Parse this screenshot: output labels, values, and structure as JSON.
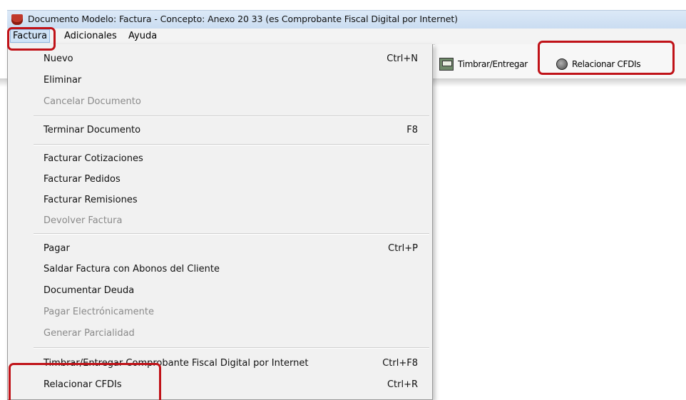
{
  "window": {
    "title": "Documento Modelo: Factura - Concepto: Anexo 20 33 (es Comprobante Fiscal Digital por Internet)"
  },
  "menubar": {
    "items": [
      "Factura",
      "Adicionales",
      "Ayuda"
    ]
  },
  "toolbar": {
    "timbrar_label": "Timbrar/Entregar",
    "relacionar_label": "Relacionar CFDIs"
  },
  "menu": {
    "items": [
      {
        "label": "Nuevo",
        "shortcut": "Ctrl+N",
        "enabled": true
      },
      {
        "label": "Eliminar",
        "shortcut": "",
        "enabled": true
      },
      {
        "label": "Cancelar Documento",
        "shortcut": "",
        "enabled": false
      },
      {
        "label": "Terminar Documento",
        "shortcut": "F8",
        "enabled": true
      },
      {
        "label": "Facturar Cotizaciones",
        "shortcut": "",
        "enabled": true
      },
      {
        "label": "Facturar Pedidos",
        "shortcut": "",
        "enabled": true
      },
      {
        "label": "Facturar Remisiones",
        "shortcut": "",
        "enabled": true
      },
      {
        "label": "Devolver Factura",
        "shortcut": "",
        "enabled": false
      },
      {
        "label": "Pagar",
        "shortcut": "Ctrl+P",
        "enabled": true
      },
      {
        "label": "Saldar Factura con Abonos del Cliente",
        "shortcut": "",
        "enabled": true
      },
      {
        "label": "Documentar Deuda",
        "shortcut": "",
        "enabled": true
      },
      {
        "label": "Pagar Electrónicamente",
        "shortcut": "",
        "enabled": false
      },
      {
        "label": "Generar Parcialidad",
        "shortcut": "",
        "enabled": false
      },
      {
        "label": "Timbrar/Entregar Comprobante Fiscal Digital por Internet",
        "shortcut": "Ctrl+F8",
        "enabled": true
      },
      {
        "label": "Relacionar CFDIs",
        "shortcut": "Ctrl+R",
        "enabled": true
      }
    ]
  },
  "colors": {
    "highlight": "#c01218",
    "disabled_text": "#8a8a8a"
  }
}
